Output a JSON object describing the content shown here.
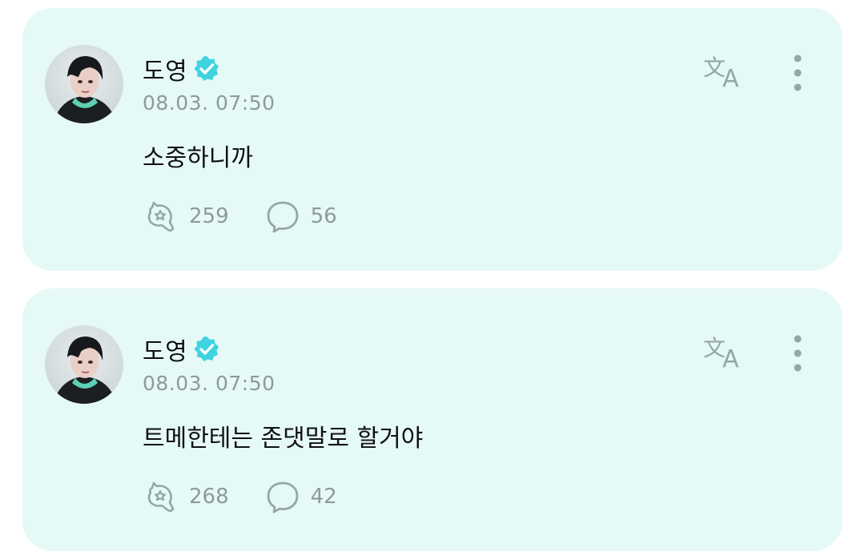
{
  "posts": [
    {
      "author": "도영",
      "timestamp": "08.03. 07:50",
      "text": "소중하니까",
      "reactions": "259",
      "comments": "56"
    },
    {
      "author": "도영",
      "timestamp": "08.03. 07:50",
      "text": "트메한테는 존댓말로 할거야",
      "reactions": "268",
      "comments": "42"
    }
  ],
  "icons": {
    "verified": "verified-badge-icon",
    "translate": "translate-icon",
    "more": "more-vertical-icon",
    "reaction": "reaction-icon",
    "comment": "comment-icon"
  },
  "colors": {
    "card_background": "#e5f9f6",
    "verified_badge": "#3fd3e0",
    "muted_text": "#8c9b99",
    "icon_gray": "#95a7a5",
    "text": "#111111"
  }
}
